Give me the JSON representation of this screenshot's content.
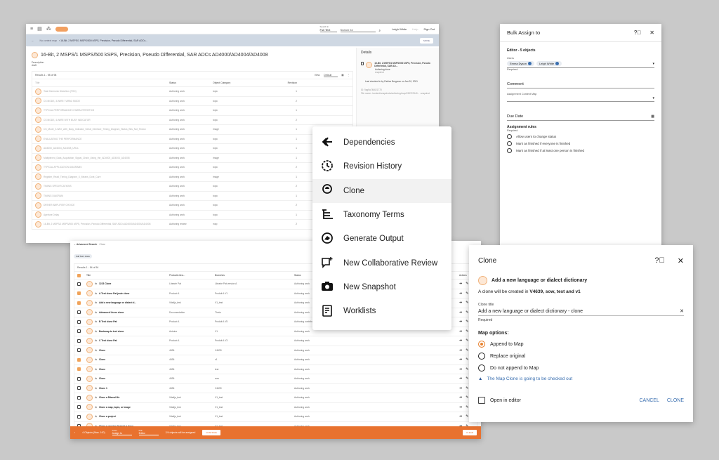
{
  "topbar": {
    "search_in_label": "Search in",
    "search_in_value": "Full Text",
    "search_placeholder": "Search for",
    "user": "Leigh White",
    "help": "Help",
    "signout": "Sign Out"
  },
  "breadcrumb": {
    "root": "No context map",
    "current": "16-Bit, 2 MSPS/1 MSPS/500 kSPS, Precision, Pseudo Differential, SAR ADCs...",
    "move": "MOVE"
  },
  "map": {
    "title": "16-Bit, 2 MSPS/1 MSPS/500 kSPS, Precision, Pseudo Differential, SAR ADCs AD4000/AD4004/AD4008",
    "description_label": "Description",
    "description": "draft"
  },
  "results1": {
    "count": "Results 1 - 98 of 98",
    "view_label": "View:",
    "view_value": "Default",
    "columns": [
      "Title",
      "Status",
      "Object Category",
      "Revision"
    ],
    "rows": [
      [
        "Total Harmonic Distortion (THD)",
        "Authoring work",
        "topic",
        "1"
      ],
      [
        "CS MODE, 3-WIRE TURBO MODE",
        "Authoring work",
        "topic",
        "2"
      ],
      [
        "TYPICAL PERFORMANCE CHARACTERISTICS",
        "Authoring work",
        "topic",
        "1"
      ],
      [
        "CS MODE, 4-WIRE WITH BUSY INDICATOR",
        "Authoring work",
        "topic",
        "2"
      ],
      [
        "CS_Mode_3-Wire_with_Busy_Indicator_Serial_Interface_Timing_Diagram_Status_Bits_Not_Shown",
        "Authoring work",
        "image",
        "1"
      ],
      [
        "EVALUATING THE PERFORMANCE",
        "Authoring work",
        "topic",
        "1"
      ],
      [
        "AD4000_AD4004_AD4008_URLs",
        "Authoring work",
        "topic",
        "1"
      ],
      [
        "Multiplexed_Data_Acquisition_Signal_Chain_Using_the_AD4000_AD4004_AD4008",
        "Authoring work",
        "image",
        "1"
      ],
      [
        "TYPICAL APPLICATION DIAGRAMS",
        "Authoring work",
        "topic",
        "2"
      ],
      [
        "Register_Read_Timing_Diagram_X_Means_Dont_Care",
        "Authoring work",
        "image",
        "1"
      ],
      [
        "TIMING SPECIFICATIONS",
        "Authoring work",
        "topic",
        "2"
      ],
      [
        "TIMING DIAGRAM",
        "Authoring work",
        "topic",
        "1"
      ],
      [
        "DRIVER AMPLIFIER CHOICE",
        "Authoring work",
        "topic",
        "2"
      ],
      [
        "Aperture Delay",
        "Authoring work",
        "topic",
        "1"
      ],
      [
        "16-Bit, 2 MSPS/1 MSPS/500 kSPS, Precision, Pseudo Differential, SAR ADCs AD4000/AD4004/AD4008",
        "Authoring review",
        "map",
        "2"
      ]
    ]
  },
  "details": {
    "title": "Details",
    "item_title": "16-Bit, 2 MSPS/1 MSPS/500 kSPS, Precision, Pseudo Differential, SAR AD...",
    "item_status": "Authoring done",
    "item_type": "snapshot",
    "checked_in": "Last checked in by Patrice Bergeron on Jan 20, 2021",
    "id": "ID: 9ag9a746621770",
    "file": "File name: /content/snapshots/authoring/map/159767640... .snapshot"
  },
  "bulk": {
    "title": "Bulk Assign to",
    "role": "Editor - 5 objects",
    "users_label": "Users",
    "users": [
      "Emma Dyson",
      "Leigh White"
    ],
    "required": "Required",
    "comment": "Comment",
    "context_map": "Assignment Context Map",
    "due_date": "Due Date",
    "rules_label": "Assignment rules",
    "rules": [
      "Allow users to change status",
      "Mark as finished if everyone is finished",
      "Mark as finished if at least one person is finished"
    ]
  },
  "menu": {
    "items": [
      "Dependencies",
      "Revision History",
      "Clone",
      "Taxonomy Terms",
      "Generate Output",
      "New Collaborative Review",
      "New Snapshot",
      "Worklists"
    ]
  },
  "search2": {
    "advanced": "Advanced Search",
    "clear": "Clear",
    "chip": "Full Text: clone",
    "count": "Results 1 - 54 of 54",
    "columns": [
      "Title",
      "Product/Libra...",
      "Branches",
      "Status",
      "Actions"
    ],
    "rows": [
      {
        "checked": false,
        "title": "1223 Clone",
        "product": "Librarie Pat",
        "branch": "Librarie Pat version A",
        "status": "Authoring work"
      },
      {
        "checked": true,
        "title": "A Test clone Pat juste clone",
        "product": "Product A",
        "branch": "Produit A V1",
        "status": "Authoring work"
      },
      {
        "checked": true,
        "title": "Add a new language or dialect d...",
        "product": "Vitalijs_test",
        "branch": "V1_test",
        "status": "Authoring work"
      },
      {
        "checked": false,
        "title": "Advanced Users clone",
        "product": "Documentation",
        "branch": "Theta",
        "status": "Authoring work"
      },
      {
        "checked": false,
        "title": "B Test clone Pat",
        "product": "Product A",
        "branch": "Produit A V5",
        "status": "Authoring contribute"
      },
      {
        "checked": false,
        "title": "Bookmap to test clone",
        "product": "Antoine",
        "branch": "V1",
        "status": "Authoring work"
      },
      {
        "checked": false,
        "title": "C Test clone Pat",
        "product": "Product A",
        "branch": "Produit A V3",
        "status": "Authoring work"
      },
      {
        "checked": false,
        "title": "Clone",
        "product": "4636",
        "branch": "V4639",
        "status": "Authoring work"
      },
      {
        "checked": true,
        "title": "Clone",
        "product": "4636",
        "branch": "v1",
        "status": "Authoring work"
      },
      {
        "checked": true,
        "title": "Clone",
        "product": "4636",
        "branch": "test",
        "status": "Authoring work"
      },
      {
        "checked": false,
        "title": "Clone",
        "product": "4636",
        "branch": "sow",
        "status": "Authoring work"
      },
      {
        "checked": false,
        "title": "Clone 1",
        "product": "4636",
        "branch": "V4639",
        "status": "Authoring work"
      },
      {
        "checked": false,
        "title": "Clone a Ditaval file",
        "product": "Vitalijs_test",
        "branch": "V1_test",
        "status": "Authoring work"
      },
      {
        "checked": false,
        "title": "Clone a map, topic, or image",
        "product": "Vitalijs_test",
        "branch": "V1_test",
        "status": "Authoring work"
      },
      {
        "checked": false,
        "title": "Clone a project",
        "product": "Vitalijs_test",
        "branch": "V1_test",
        "status": "Authoring work"
      },
      {
        "checked": false,
        "title": "Clone a version (branch a docu...",
        "product": "Vitalijs_test",
        "branch": "V1_test",
        "status": "Authoring work"
      }
    ],
    "bar": {
      "objects": "4 Objects (Max. 100)",
      "action_label": "Action",
      "action_value": "Assign to",
      "role_label": "Role",
      "role_value": "Editor",
      "notice": "2/4 objects will be assigned",
      "continue": "CONTINUE",
      "clear": "CLEAR"
    }
  },
  "clone": {
    "title": "Clone",
    "object": "Add a new language or dialect dictionary",
    "info_prefix": "A clone will be created in ",
    "info_targets": "V4639, sow, test and v1",
    "title_label": "Clone title",
    "title_value": "Add a new language or dialect dictionary - clone",
    "required": "Required",
    "map_options_label": "Map options:",
    "options": [
      "Append to Map",
      "Replace original",
      "Do not append to Map"
    ],
    "selected_option": 0,
    "warning": "The Map Clone is going to be checked out",
    "open_in_editor": "Open in editor",
    "cancel": "CANCEL",
    "clone": "CLONE"
  }
}
